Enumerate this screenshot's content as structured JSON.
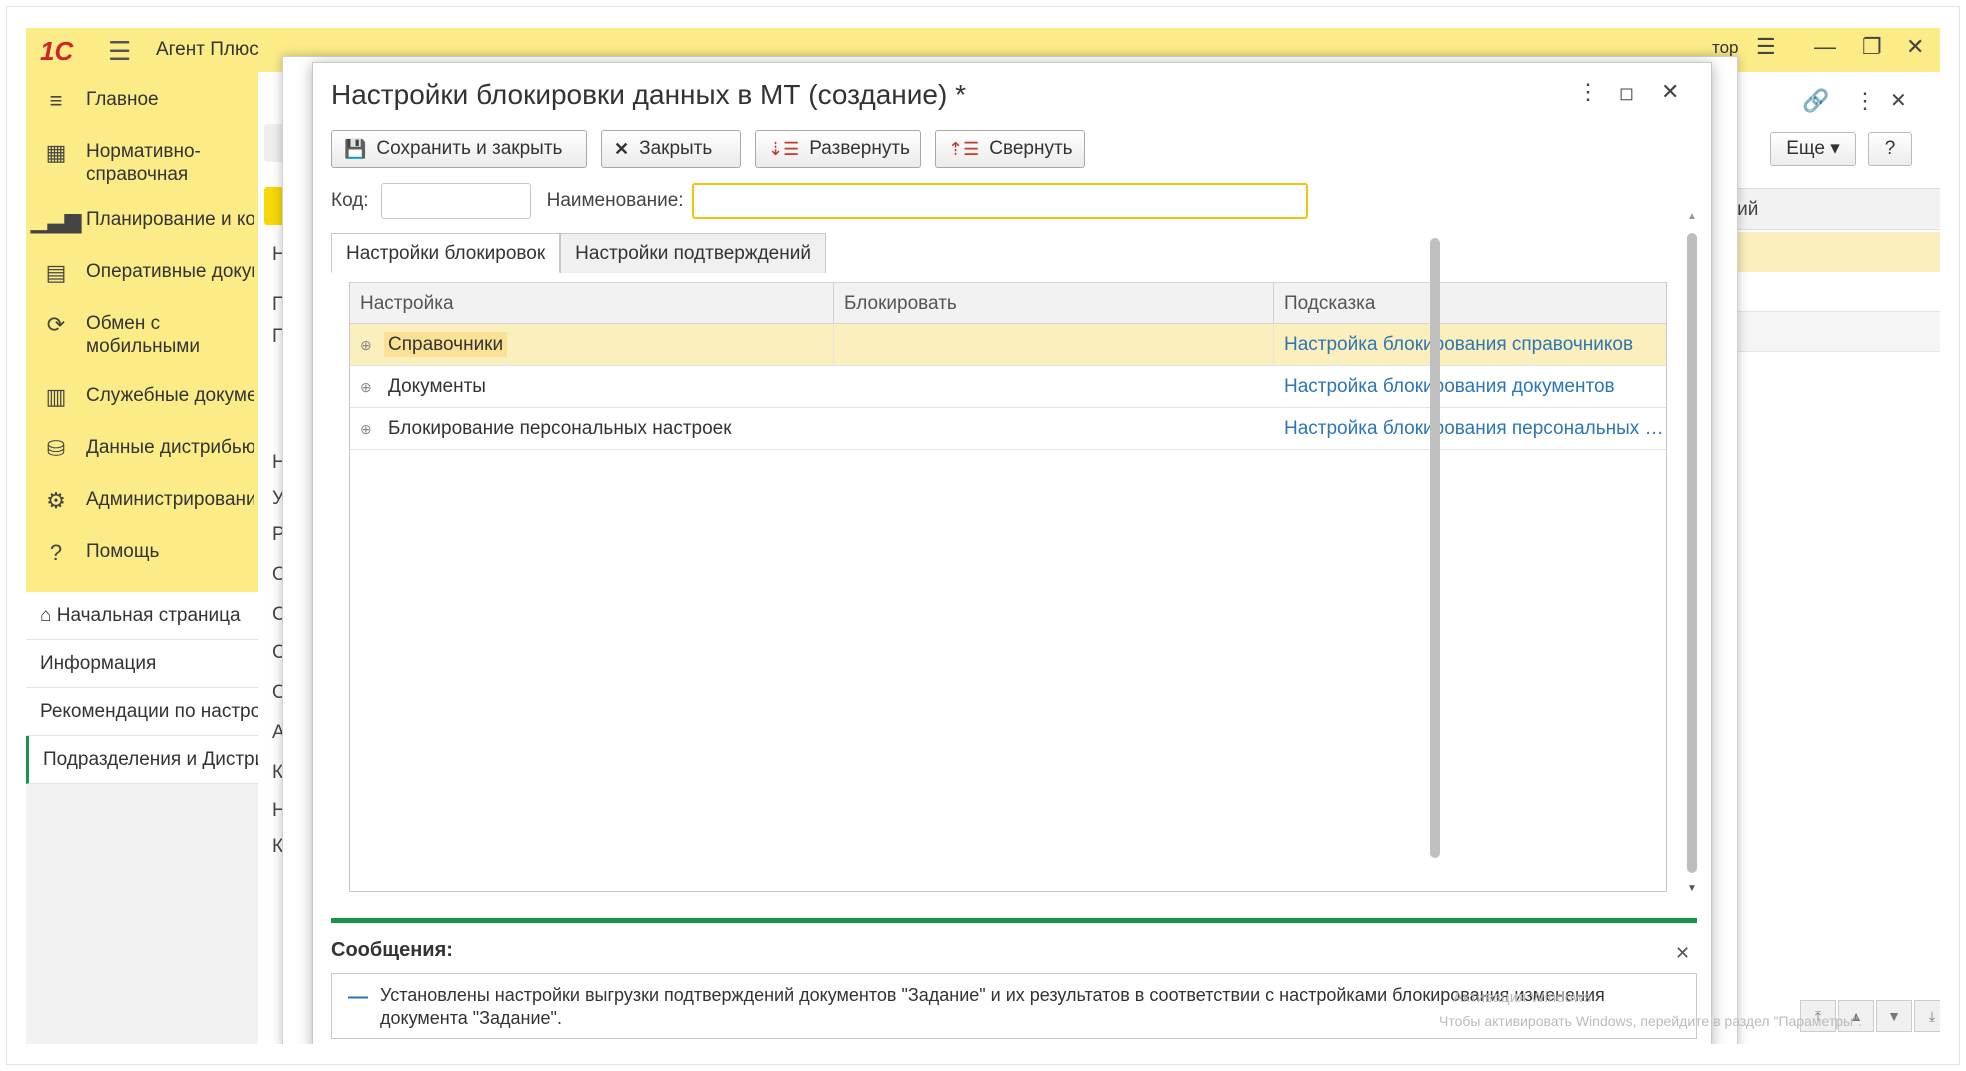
{
  "app": {
    "logo": "1С",
    "title": "Агент Плюс",
    "topbar_right_text": "тор"
  },
  "sidebar": {
    "items": [
      {
        "icon": "menu-icon",
        "label": "Главное"
      },
      {
        "icon": "grid-icon",
        "label": "Нормативно-справочная информация"
      },
      {
        "icon": "chart-icon",
        "label": "Планирование и контроль"
      },
      {
        "icon": "documents-icon",
        "label": "Оперативные документы"
      },
      {
        "icon": "sync-icon",
        "label": "Обмен с мобильными устройствами"
      },
      {
        "icon": "service-docs-icon",
        "label": "Служебные документы"
      },
      {
        "icon": "distributor-icon",
        "label": "Данные дистрибьютора"
      },
      {
        "icon": "gear-icon",
        "label": "Администрирование"
      },
      {
        "icon": "help-icon",
        "label": "Помощь"
      }
    ],
    "nav": [
      {
        "label": "Начальная страница"
      },
      {
        "label": "Информация"
      },
      {
        "label": "Рекомендации по настройке"
      },
      {
        "label": "Подразделения и Дистрибьюторы"
      }
    ]
  },
  "background": {
    "letters": [
      "Н",
      "П",
      "Г",
      "Н",
      "У",
      "Р",
      "О",
      "С",
      "С",
      "О",
      "А",
      "К",
      "Н",
      "К"
    ],
    "more_button": "Еще",
    "help_button": "?",
    "column_fragment": "арий"
  },
  "modal": {
    "title": "Настройки блокировки данных в МТ (создание) *",
    "toolbar": {
      "save_close": "Сохранить и закрыть",
      "close": "Закрыть",
      "expand": "Развернуть",
      "collapse": "Свернуть"
    },
    "fields": {
      "code_label": "Код:",
      "code_value": "",
      "name_label": "Наименование:",
      "name_value": ""
    },
    "tabs": [
      "Настройки блокировок",
      "Настройки подтверждений"
    ],
    "grid": {
      "columns": [
        "Настройка",
        "Блокировать",
        "Подсказка"
      ],
      "rows": [
        {
          "setting": "Справочники",
          "block": "",
          "hint": "Настройка блокирования справочников"
        },
        {
          "setting": "Документы",
          "block": "",
          "hint": "Настройка блокирования документов"
        },
        {
          "setting": "Блокирование персональных настроек",
          "block": "",
          "hint": "Настройка блокирования персональных настроек"
        }
      ]
    },
    "messages": {
      "title": "Сообщения:",
      "text": "Установлены настройки выгрузки подтверждений документов \"Задание\" и их результатов в соответствии с настройками блокирования изменения документа \"Задание\"."
    },
    "watermark": {
      "line1": "Активация Windows",
      "line2": "Чтобы активировать Windows, перейдите в раздел \"Параметры\"."
    }
  }
}
